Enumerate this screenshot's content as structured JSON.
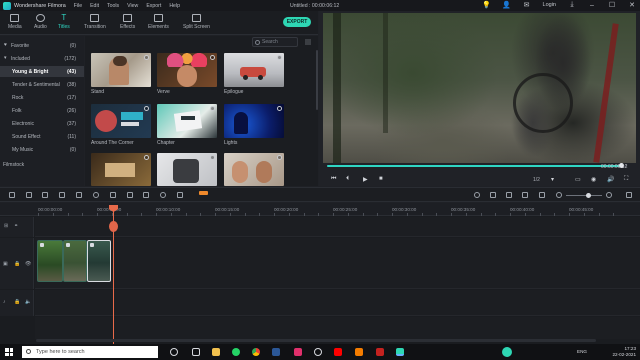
{
  "app": {
    "name": "Wondershare Filmora",
    "menu": [
      "File",
      "Edit",
      "Tools",
      "View",
      "Export",
      "Help"
    ],
    "project_title": "Untitled : 00:00:06:12",
    "login_label": "Login"
  },
  "toolbar": {
    "tabs": [
      {
        "label": "Media",
        "icon": "media-icon"
      },
      {
        "label": "Audio",
        "icon": "audio-icon"
      },
      {
        "label": "Titles",
        "icon": "titles-icon"
      },
      {
        "label": "Transition",
        "icon": "transition-icon"
      },
      {
        "label": "Effects",
        "icon": "effects-icon"
      },
      {
        "label": "Elements",
        "icon": "elements-icon"
      },
      {
        "label": "Split Screen",
        "icon": "split-screen-icon"
      }
    ],
    "active_tab": "Titles",
    "export_label": "EXPORT",
    "accent_color": "#2fd6c3",
    "export_color": "#2ed7b4"
  },
  "categories": {
    "favorite": {
      "label": "Favorite",
      "count": "(0)"
    },
    "included": {
      "label": "Included",
      "count": "(172)"
    },
    "items": [
      {
        "label": "Young & Bright",
        "count": "(43)",
        "selected": true
      },
      {
        "label": "Tender & Sentimental",
        "count": "(38)"
      },
      {
        "label": "Rock",
        "count": "(17)"
      },
      {
        "label": "Folk",
        "count": "(26)"
      },
      {
        "label": "Electronic",
        "count": "(37)"
      },
      {
        "label": "Sound Effect",
        "count": "(11)"
      },
      {
        "label": "My Music",
        "count": "(0)"
      }
    ],
    "filmstock": "Filmstock"
  },
  "media": {
    "search_placeholder": "Search",
    "thumbnails": [
      {
        "label": "Stand"
      },
      {
        "label": "Verve"
      },
      {
        "label": "Epilogue"
      },
      {
        "label": "Around The Corner"
      },
      {
        "label": "Chapter"
      },
      {
        "label": "Lights"
      },
      {
        "label": ""
      },
      {
        "label": ""
      },
      {
        "label": ""
      }
    ]
  },
  "preview": {
    "timecode": "00:00:06:12",
    "ratio": "1/2",
    "playback_progress": 0.98
  },
  "timeline": {
    "ruler": [
      "00:00:00:00",
      "00:00:05:00",
      "00:00:10:00",
      "00:00:15:00",
      "00:00:20:00",
      "00:00:25:00",
      "00:00:30:00",
      "00:00:35:00",
      "00:00:40:00",
      "00:00:45:00"
    ],
    "playhead_color": "#e86a4a"
  },
  "taskbar": {
    "search_placeholder": "Type here to search",
    "language": "ENG",
    "time": "17:23",
    "date": "22-02-2021"
  }
}
